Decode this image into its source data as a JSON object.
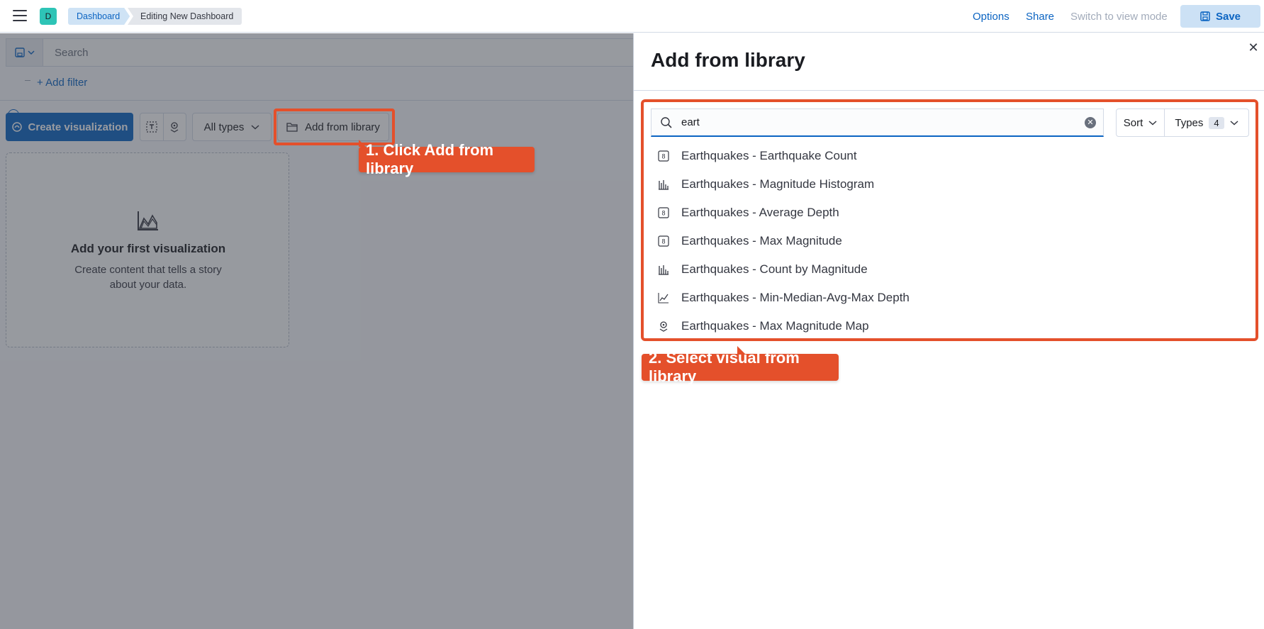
{
  "header": {
    "space_initial": "D",
    "breadcrumbs": [
      "Dashboard",
      "Editing New Dashboard"
    ],
    "links": {
      "options": "Options",
      "share": "Share",
      "view_mode": "Switch to view mode"
    },
    "save_label": "Save"
  },
  "query_bar": {
    "search_placeholder": "Search",
    "add_filter": "+ Add filter"
  },
  "toolbar": {
    "create_label": "Create visualization",
    "types_label": "All types",
    "library_label": "Add from library"
  },
  "empty_panel": {
    "title": "Add your first visualization",
    "description": "Create content that tells a story about your data."
  },
  "flyout": {
    "title": "Add from library",
    "search_value": "eart",
    "sort_label": "Sort",
    "types_label": "Types",
    "types_count": "4",
    "results": [
      {
        "label": "Earthquakes - Earthquake Count",
        "icon": "metric-icon"
      },
      {
        "label": "Earthquakes - Magnitude Histogram",
        "icon": "bar-chart-icon"
      },
      {
        "label": "Earthquakes - Average Depth",
        "icon": "metric-icon"
      },
      {
        "label": "Earthquakes - Max Magnitude",
        "icon": "metric-icon"
      },
      {
        "label": "Earthquakes - Count by Magnitude",
        "icon": "bar-chart-icon"
      },
      {
        "label": "Earthquakes - Min-Median-Avg-Max Depth",
        "icon": "line-chart-icon"
      },
      {
        "label": "Earthquakes - Max Magnitude Map",
        "icon": "map-icon"
      }
    ]
  },
  "annotations": {
    "step1": "1. Click Add from library",
    "step2": "2. Select visual from library"
  },
  "colors": {
    "accent": "#0b64c2",
    "highlight": "#e4502b",
    "space_avatar": "#2ec4b6"
  }
}
